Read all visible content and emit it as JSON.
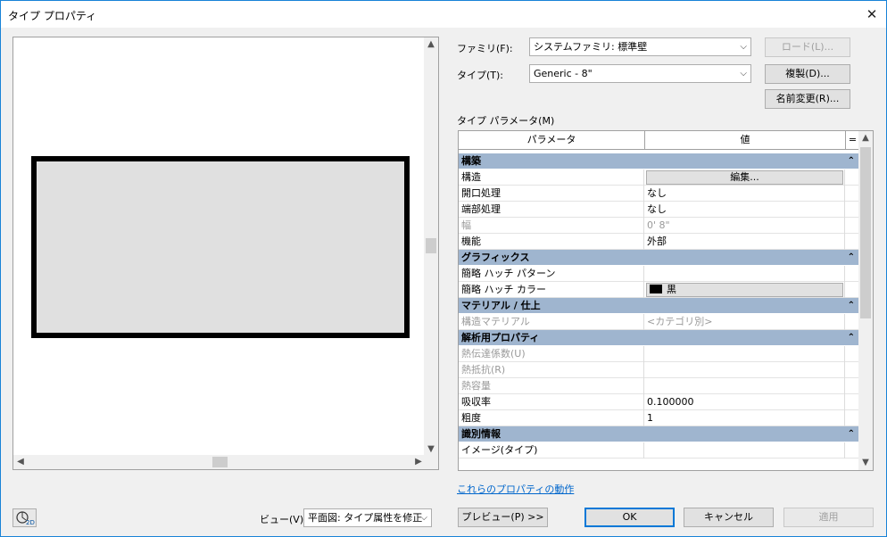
{
  "window": {
    "title": "タイプ プロパティ",
    "close_glyph": "✕"
  },
  "form": {
    "family_label": "ファミリ(F):",
    "family_value": "システムファミリ: 標準壁",
    "type_label": "タイプ(T):",
    "type_value": "Generic - 8\"",
    "load_button": "ロード(L)...",
    "duplicate_button": "複製(D)...",
    "rename_button": "名前変更(R)...",
    "type_params_label": "タイプ パラメータ(M)"
  },
  "grid": {
    "col_param": "パラメータ",
    "col_value": "値",
    "col_eq": "=",
    "categories": [
      {
        "name": "構築",
        "rows": [
          {
            "param": "構造",
            "value": "編集...",
            "kind": "button"
          },
          {
            "param": "開口処理",
            "value": "なし"
          },
          {
            "param": "端部処理",
            "value": "なし"
          },
          {
            "param": "幅",
            "value": "0'  8\"",
            "disabled": true
          },
          {
            "param": "機能",
            "value": "外部"
          }
        ]
      },
      {
        "name": "グラフィックス",
        "rows": [
          {
            "param": "簡略 ハッチ パターン",
            "value": ""
          },
          {
            "param": "簡略 ハッチ カラー",
            "value": "黒",
            "kind": "color",
            "color": "#000000"
          }
        ]
      },
      {
        "name": "マテリアル / 仕上",
        "rows": [
          {
            "param": "構造マテリアル",
            "value": "<カテゴリ別>",
            "disabled": true
          }
        ]
      },
      {
        "name": "解析用プロパティ",
        "rows": [
          {
            "param": "熱伝達係数(U)",
            "value": "",
            "disabled": true
          },
          {
            "param": "熱抵抗(R)",
            "value": "",
            "disabled": true
          },
          {
            "param": "熱容量",
            "value": "",
            "disabled": true
          },
          {
            "param": "吸収率",
            "value": "0.100000"
          },
          {
            "param": "粗度",
            "value": "1"
          }
        ]
      },
      {
        "name": "識別情報",
        "rows": [
          {
            "param": "イメージ(タイプ)",
            "value": ""
          }
        ]
      }
    ]
  },
  "footer": {
    "help_link": "これらのプロパティの動作",
    "view_label": "ビュー(V):",
    "view_value": "平面図: タイプ属性を修正",
    "preview_button": "プレビュー(P) >>",
    "ok_button": "OK",
    "cancel_button": "キャンセル",
    "apply_button": "適用"
  },
  "colors": {
    "category_band": "#9fb5cf",
    "accent": "#0078d7",
    "link": "#0066cc"
  }
}
